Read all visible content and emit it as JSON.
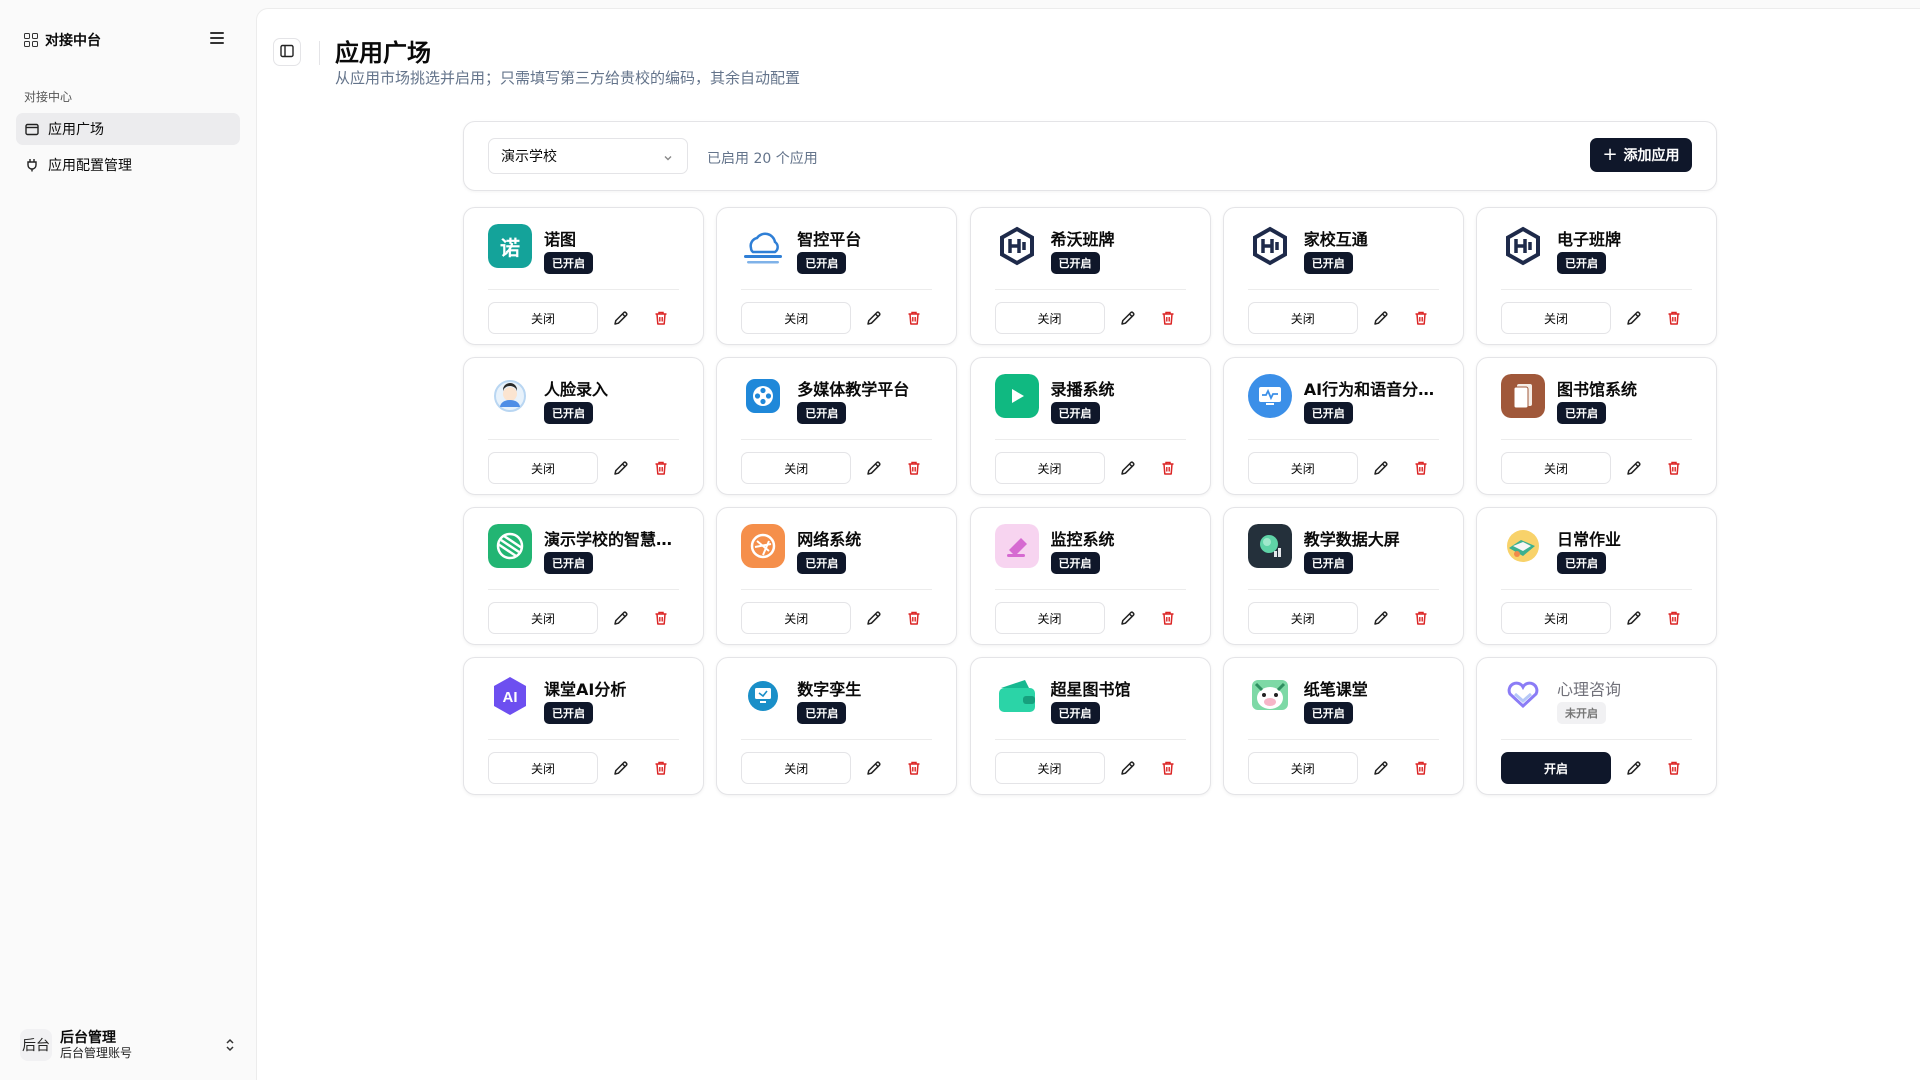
{
  "sidebar": {
    "title": "对接中台",
    "group_label": "对接中心",
    "items": [
      {
        "label": "应用广场",
        "active": true
      },
      {
        "label": "应用配置管理",
        "active": false
      }
    ],
    "user": {
      "avatar_text": "后台",
      "name": "后台管理",
      "account": "后台管理账号"
    }
  },
  "header": {
    "title": "应用广场",
    "subtitle": "从应用市场挑选并启用；只需填写第三方给贵校的编码，其余自动配置"
  },
  "toolbar": {
    "school_select": "演示学校",
    "enabled_count_text": "已启用 20 个应用",
    "add_label": "添加应用"
  },
  "labels": {
    "enabled": "已开启",
    "disabled": "未开启",
    "close": "关闭",
    "open": "开启"
  },
  "icon_text": {
    "nuotu": "诺",
    "ai": "AI"
  },
  "colors": {
    "primary": "#0f172a",
    "delete": "#dc2626"
  },
  "apps": [
    {
      "name": "诺图",
      "status": "已开启",
      "action": "关闭",
      "icon": "nuotu-icon"
    },
    {
      "name": "智控平台",
      "status": "已开启",
      "action": "关闭",
      "icon": "cloud-icon"
    },
    {
      "name": "希沃班牌",
      "status": "已开启",
      "action": "关闭",
      "icon": "hexagon-logo-icon"
    },
    {
      "name": "家校互通",
      "status": "已开启",
      "action": "关闭",
      "icon": "hexagon-logo-icon"
    },
    {
      "name": "电子班牌",
      "status": "已开启",
      "action": "关闭",
      "icon": "hexagon-logo-icon"
    },
    {
      "name": "人脸录入",
      "status": "已开启",
      "action": "关闭",
      "icon": "face-icon"
    },
    {
      "name": "多媒体教学平台",
      "status": "已开启",
      "action": "关闭",
      "icon": "film-reel-icon"
    },
    {
      "name": "录播系统",
      "status": "已开启",
      "action": "关闭",
      "icon": "play-icon"
    },
    {
      "name": "AI行为和语音分…",
      "status": "已开启",
      "action": "关闭",
      "icon": "monitor-pulse-icon"
    },
    {
      "name": "图书馆系统",
      "status": "已开启",
      "action": "关闭",
      "icon": "library-book-icon"
    },
    {
      "name": "演示学校的智慧…",
      "status": "已开启",
      "action": "关闭",
      "icon": "sports-ball-icon"
    },
    {
      "name": "网络系统",
      "status": "已开启",
      "action": "关闭",
      "icon": "network-icon"
    },
    {
      "name": "监控系统",
      "status": "已开启",
      "action": "关闭",
      "icon": "camera-icon"
    },
    {
      "name": "教学数据大屏",
      "status": "已开启",
      "action": "关闭",
      "icon": "data-screen-icon"
    },
    {
      "name": "日常作业",
      "status": "已开启",
      "action": "关闭",
      "icon": "homework-icon"
    },
    {
      "name": "课堂AI分析",
      "status": "已开启",
      "action": "关闭",
      "icon": "ai-hexagon-icon"
    },
    {
      "name": "数字孪生",
      "status": "已开启",
      "action": "关闭",
      "icon": "digital-twin-icon"
    },
    {
      "name": "超星图书馆",
      "status": "已开启",
      "action": "关闭",
      "icon": "wallet-icon"
    },
    {
      "name": "纸笔课堂",
      "status": "已开启",
      "action": "关闭",
      "icon": "cartoon-pig-icon"
    },
    {
      "name": "心理咨询",
      "status": "未开启",
      "action": "开启",
      "icon": "heart-ribbon-icon"
    }
  ]
}
